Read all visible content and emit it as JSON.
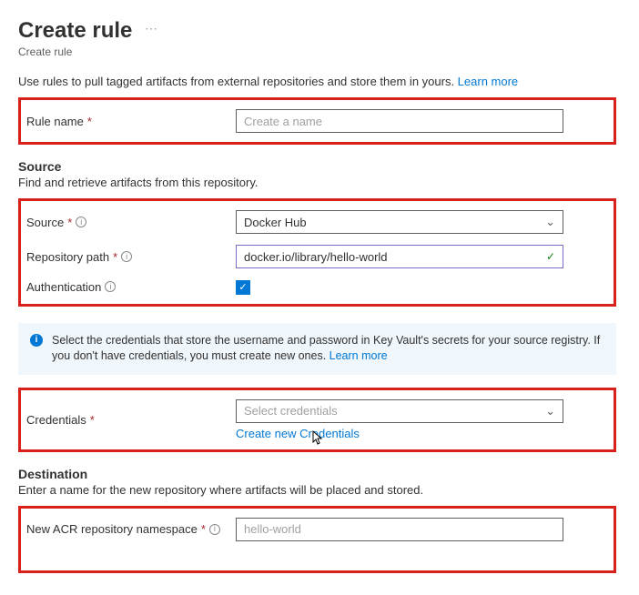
{
  "header": {
    "title": "Create rule",
    "breadcrumb": "Create rule"
  },
  "intro": {
    "text": "Use rules to pull tagged artifacts from external repositories and store them in yours. ",
    "link": "Learn more"
  },
  "rule_name": {
    "label": "Rule name",
    "placeholder": "Create a name",
    "value": ""
  },
  "source": {
    "heading": "Source",
    "desc": "Find and retrieve artifacts from this repository.",
    "source_label": "Source",
    "source_value": "Docker Hub",
    "repo_label": "Repository path",
    "repo_value": "docker.io/library/hello-world",
    "auth_label": "Authentication",
    "auth_checked": true
  },
  "info": {
    "text": "Select the credentials that store the username and password in Key Vault's secrets for your source registry. If you don't have credentials, you must create new ones. ",
    "link": "Learn more"
  },
  "credentials": {
    "label": "Credentials",
    "placeholder": "Select credentials",
    "create_link": "Create new Credentials"
  },
  "destination": {
    "heading": "Destination",
    "desc": "Enter a name for the new repository where artifacts will be placed and stored.",
    "ns_label": "New ACR repository namespace",
    "ns_placeholder": "hello-world",
    "ns_value": ""
  }
}
